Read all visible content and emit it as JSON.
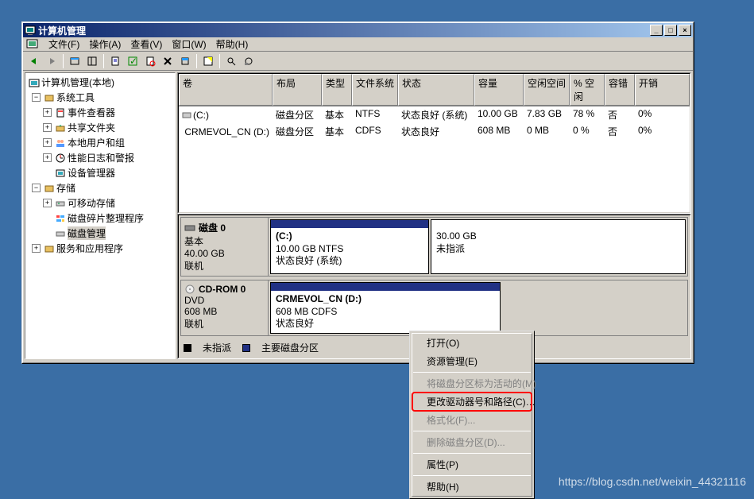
{
  "window": {
    "title": "计算机管理"
  },
  "menu": {
    "file": "文件(F)",
    "action": "操作(A)",
    "view": "查看(V)",
    "window": "窗口(W)",
    "help": "帮助(H)"
  },
  "tree": {
    "root": "计算机管理(本地)",
    "sys_tools": "系统工具",
    "event_viewer": "事件查看器",
    "shared": "共享文件夹",
    "users": "本地用户和组",
    "perf": "性能日志和警报",
    "device": "设备管理器",
    "storage": "存储",
    "removable": "可移动存储",
    "defrag": "磁盘碎片整理程序",
    "diskmgmt": "磁盘管理",
    "services": "服务和应用程序"
  },
  "columns": {
    "volume": "卷",
    "layout": "布局",
    "type": "类型",
    "fs": "文件系统",
    "status": "状态",
    "capacity": "容量",
    "free": "空闲空间",
    "pct": "% 空闲",
    "fault": "容错",
    "overhead": "开销"
  },
  "volumes": [
    {
      "name": " (C:)",
      "layout": "磁盘分区",
      "type": "基本",
      "fs": "NTFS",
      "status": "状态良好 (系统)",
      "cap": "10.00 GB",
      "free": "7.83 GB",
      "pct": "78 %",
      "fault": "否",
      "oh": "0%"
    },
    {
      "name": "CRMEVOL_CN (D:)",
      "layout": "磁盘分区",
      "type": "基本",
      "fs": "CDFS",
      "status": "状态良好",
      "cap": "608 MB",
      "free": "0 MB",
      "pct": "0 %",
      "fault": "否",
      "oh": "0%"
    }
  ],
  "disks": {
    "disk0": {
      "title": "磁盘 0",
      "kind": "基本",
      "size": "40.00 GB",
      "state": "联机",
      "p1": {
        "name": "(C:)",
        "l2": "10.00 GB NTFS",
        "l3": "状态良好 (系统)"
      },
      "p2": {
        "name": "30.00 GB",
        "l2": "未指派"
      }
    },
    "cd": {
      "title": "CD-ROM 0",
      "kind": "DVD",
      "size": "608 MB",
      "state": "联机",
      "p1": {
        "name": "CRMEVOL_CN  (D:)",
        "l2": "608 MB CDFS",
        "l3": "状态良好"
      }
    }
  },
  "legend": {
    "unalloc": "未指派",
    "primary": "主要磁盘分区"
  },
  "context_menu": {
    "open": "打开(O)",
    "explore": "资源管理(E)",
    "mark_active": "将磁盘分区标为活动的(M)",
    "change_path": "更改驱动器号和路径(C)…",
    "format": "格式化(F)...",
    "delete": "删除磁盘分区(D)...",
    "props": "属性(P)",
    "help": "帮助(H)"
  },
  "watermark": "https://blog.csdn.net/weixin_44321116"
}
